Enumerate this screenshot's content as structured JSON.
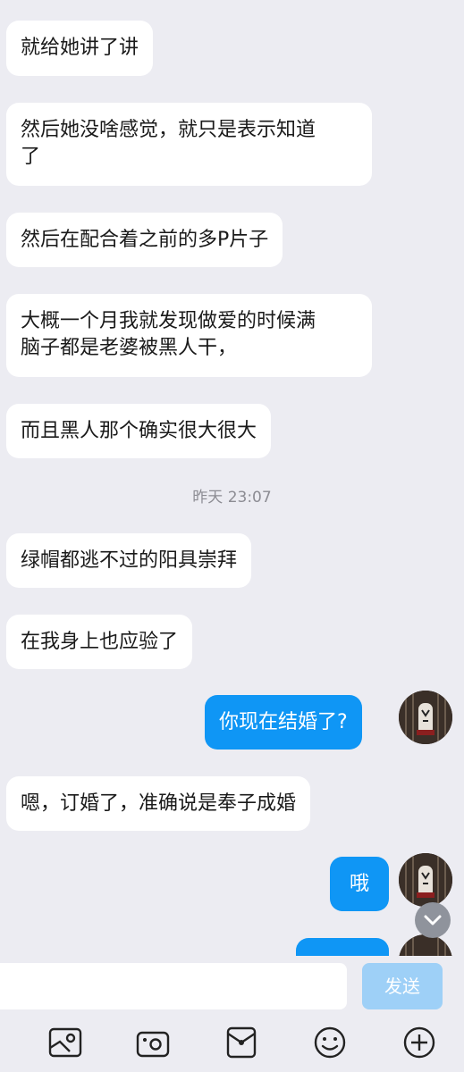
{
  "messages": [
    {
      "side": "left",
      "text": "就给她讲了讲"
    },
    {
      "side": "left",
      "text": "然后她没啥感觉，就只是表示知道\n了"
    },
    {
      "side": "left",
      "text": "然后在配合着之前的多P片子"
    },
    {
      "side": "left",
      "text": "大概一个月我就发现做爱的时候满\n脑子都是老婆被黑人干，"
    },
    {
      "side": "left",
      "text": "而且黑人那个确实很大很大"
    },
    {
      "side": "left",
      "text": "绿帽都逃不过的阳具崇拜"
    },
    {
      "side": "left",
      "text": "在我身上也应验了"
    },
    {
      "side": "right",
      "text": "你现在结婚了?"
    },
    {
      "side": "left",
      "text": "嗯，订婚了，准确说是奉子成婚"
    },
    {
      "side": "right",
      "text": "哦"
    },
    {
      "side": "right",
      "text": ""
    }
  ],
  "timestamp": "昨天 23:07",
  "input": {
    "value": "",
    "placeholder": ""
  },
  "send_label": "发送",
  "toolbar_icons": [
    "image-icon",
    "camera-icon",
    "red-packet-icon",
    "emoji-icon",
    "plus-icon"
  ],
  "colors": {
    "background": "#ececf2",
    "incoming_bubble": "#ffffff",
    "outgoing_bubble": "#0f96f5",
    "send_button": "#9ed0f7"
  }
}
